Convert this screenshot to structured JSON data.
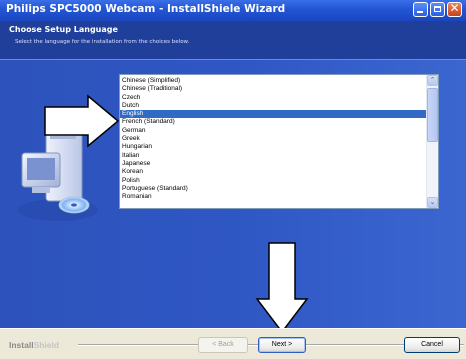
{
  "window": {
    "title": "Philips SPC5000 Webcam - InstallShiele Wizard"
  },
  "header": {
    "title": "Choose Setup Language",
    "subtitle": "Select the language for the installation from the choices below."
  },
  "languages": {
    "items": [
      "Chinese (Simplified)",
      "Chinese (Traditional)",
      "Czech",
      "Dutch",
      "English",
      "French (Standard)",
      "German",
      "Greek",
      "Hungarian",
      "Italian",
      "Japanese",
      "Korean",
      "Polish",
      "Portuguese (Standard)",
      "Romanian"
    ],
    "selected": "English"
  },
  "footer": {
    "brand_install": "Install",
    "brand_shield": "Shield",
    "back_label": "< Back",
    "next_label": "Next >",
    "cancel_label": "Cancel"
  },
  "colors": {
    "titlebar": "#2457d5",
    "main_bg": "#2f57c4",
    "selection": "#316ac5",
    "footer_bg": "#ece9d8"
  },
  "icons": {
    "minimize": "minimize-icon",
    "maximize": "maximize-icon",
    "close": "close-icon",
    "scroll_up": "scroll-up-icon",
    "scroll_down": "scroll-down-icon",
    "computer": "computer-cd-icon",
    "arrow_right": "arrow-right-icon",
    "arrow_down": "arrow-down-icon"
  }
}
